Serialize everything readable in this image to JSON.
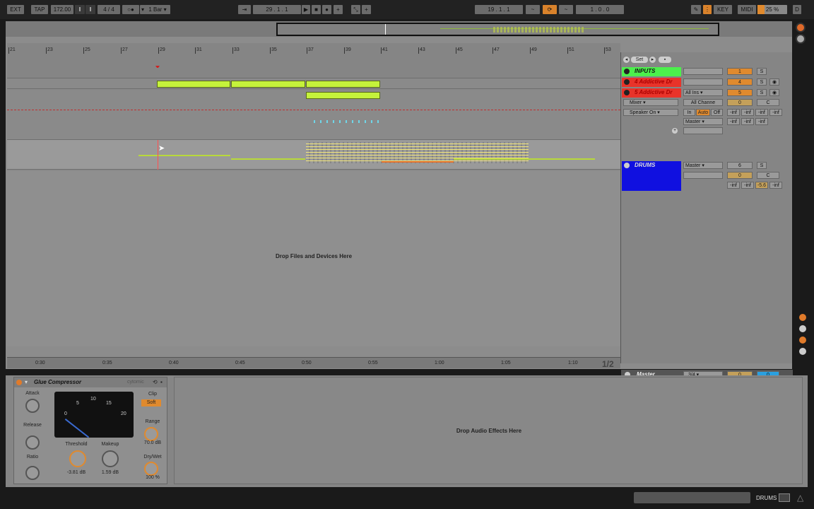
{
  "transport": {
    "ext": "EXT",
    "tap": "TAP",
    "tempo": "172.00",
    "time_sig_num": "4",
    "time_sig_den": "4",
    "metro": "○●",
    "quantize": "1 Bar",
    "position": "29 .   1 .   1",
    "loop_start": "19 .   1 .   1",
    "loop_length": "1 .   0 .   0",
    "key": "KEY",
    "midi": "MIDI",
    "cpu": "25 %",
    "disk": "D"
  },
  "ruler": {
    "bars": [
      "21",
      "23",
      "25",
      "27",
      "29",
      "31",
      "33",
      "35",
      "37",
      "39",
      "41",
      "43",
      "45",
      "47",
      "49",
      "51",
      "53"
    ]
  },
  "timeline": {
    "times": [
      "0:30",
      "0:35",
      "0:40",
      "0:45",
      "0:50",
      "0:55",
      "1:00",
      "1:05",
      "1:10"
    ],
    "page": "1/2"
  },
  "arrangement": {
    "drop_text": "Drop Files and Devices Here"
  },
  "mixer": {
    "set_label": "Set",
    "tracks": [
      {
        "name": "INPUTS",
        "color": "#4cf04c",
        "number": "1",
        "solo": "S"
      },
      {
        "name": "4 Addictive Dr",
        "color": "#e8332a",
        "number": "4",
        "solo": "S"
      },
      {
        "name": "5 Addictive Dr",
        "color": "#e8332a",
        "number": "5",
        "solo": "S"
      },
      {
        "name": "DRUMS",
        "color": "#1010e0",
        "number": "6",
        "solo": "S"
      }
    ],
    "input_type": "All Ins",
    "input_channel": "All Channe",
    "mixer_label": "Mixer",
    "speaker": "Speaker On",
    "monitor_in": "In",
    "monitor_auto": "Auto",
    "monitor_off": "Off",
    "output": "Master",
    "output2": "Master",
    "volume_val": "0",
    "pan_val": "C",
    "inf": "-inf",
    "sends_val": "-5.6",
    "master_name": "Master",
    "master_ratio": "3/4",
    "master_vol": "0",
    "master_pan": "0"
  },
  "device": {
    "name": "Glue Compressor",
    "brand": "cytomic",
    "attack_label": "Attack",
    "release_label": "Release",
    "ratio_label": "Ratio",
    "threshold_label": "Threshold",
    "threshold_value": "-3.81 dB",
    "makeup_label": "Makeup",
    "makeup_value": "1.59 dB",
    "clip_label": "Clip",
    "soft_label": "Soft",
    "range_label": "Range",
    "range_value": "70.0 dB",
    "drywet_label": "Dry/Wet",
    "drywet_value": "100 %",
    "meter_scale": [
      "0",
      "5",
      "10",
      "15",
      "20"
    ],
    "drop_text": "Drop Audio Effects Here"
  },
  "status": {
    "track": "DRUMS"
  }
}
